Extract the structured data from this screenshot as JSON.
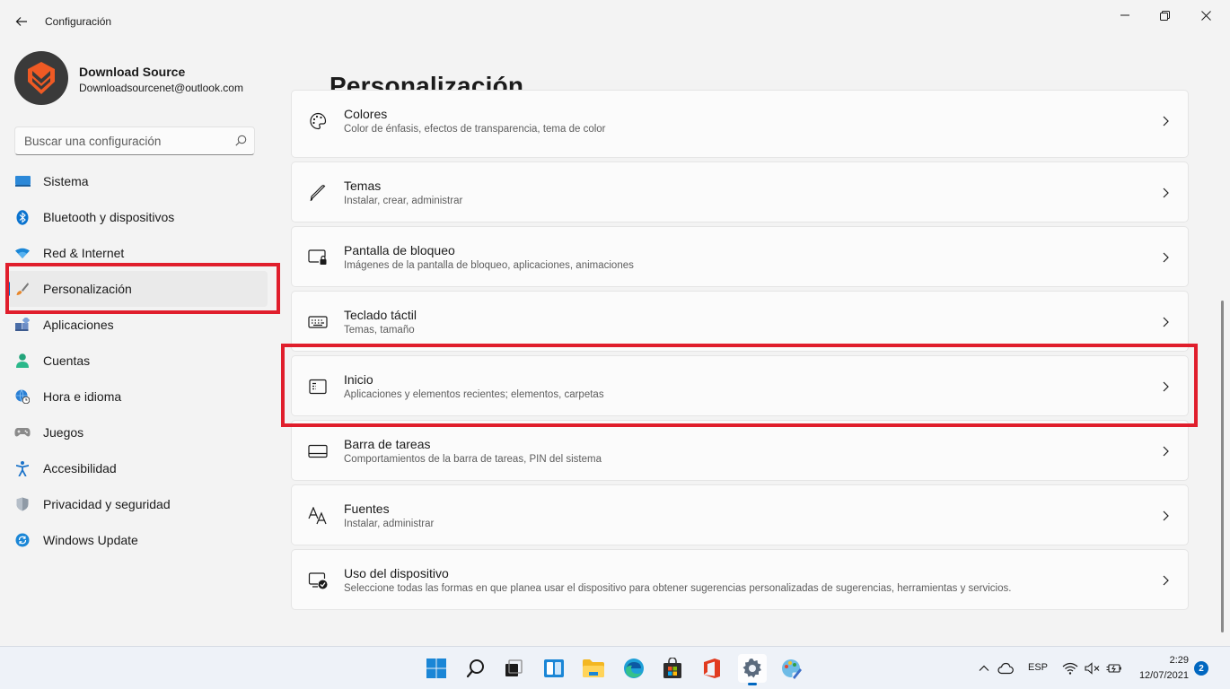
{
  "window": {
    "title": "Configuración"
  },
  "profile": {
    "name": "Download Source",
    "email": "Downloadsourcenet@outlook.com"
  },
  "search": {
    "placeholder": "Buscar una configuración"
  },
  "sidebar": {
    "items": [
      {
        "label": "Sistema",
        "icon": "system-icon"
      },
      {
        "label": "Bluetooth y dispositivos",
        "icon": "bluetooth-icon"
      },
      {
        "label": "Red & Internet",
        "icon": "wifi-icon"
      },
      {
        "label": "Personalización",
        "icon": "brush-icon",
        "selected": true
      },
      {
        "label": "Aplicaciones",
        "icon": "apps-icon"
      },
      {
        "label": "Cuentas",
        "icon": "person-icon"
      },
      {
        "label": "Hora e idioma",
        "icon": "globe-clock-icon"
      },
      {
        "label": "Juegos",
        "icon": "gamepad-icon"
      },
      {
        "label": "Accesibilidad",
        "icon": "accessibility-icon"
      },
      {
        "label": "Privacidad y seguridad",
        "icon": "shield-icon"
      },
      {
        "label": "Windows Update",
        "icon": "update-icon"
      }
    ]
  },
  "main": {
    "title": "Personalización",
    "cards": [
      {
        "title": "Colores",
        "subtitle": "Color de énfasis, efectos de transparencia, tema de color",
        "icon": "palette-icon"
      },
      {
        "title": "Temas",
        "subtitle": "Instalar, crear, administrar",
        "icon": "pen-icon"
      },
      {
        "title": "Pantalla de bloqueo",
        "subtitle": "Imágenes de la pantalla de bloqueo, aplicaciones, animaciones",
        "icon": "lock-screen-icon"
      },
      {
        "title": "Teclado táctil",
        "subtitle": "Temas, tamaño",
        "icon": "keyboard-icon"
      },
      {
        "title": "Inicio",
        "subtitle": "Aplicaciones y elementos recientes; elementos, carpetas",
        "icon": "start-menu-icon"
      },
      {
        "title": "Barra de tareas",
        "subtitle": "Comportamientos de la barra de tareas, PIN del sistema",
        "icon": "taskbar-icon"
      },
      {
        "title": "Fuentes",
        "subtitle": "Instalar, administrar",
        "icon": "font-icon"
      },
      {
        "title": "Uso del dispositivo",
        "subtitle": "Seleccione todas las formas en que planea usar el dispositivo para obtener sugerencias personalizadas de sugerencias, herramientas y servicios.",
        "icon": "device-usage-icon"
      }
    ]
  },
  "taskbar": {
    "apps": [
      "windows-start-icon",
      "search-icon",
      "task-view-icon",
      "widgets-icon",
      "file-explorer-icon",
      "edge-icon",
      "store-icon",
      "office-icon",
      "settings-icon",
      "paint-icon"
    ],
    "language": "ESP",
    "time": "2:29",
    "date": "12/07/2021",
    "notifications": "2"
  },
  "colors": {
    "accent": "#0067c0",
    "highlight": "#e01e2c"
  }
}
